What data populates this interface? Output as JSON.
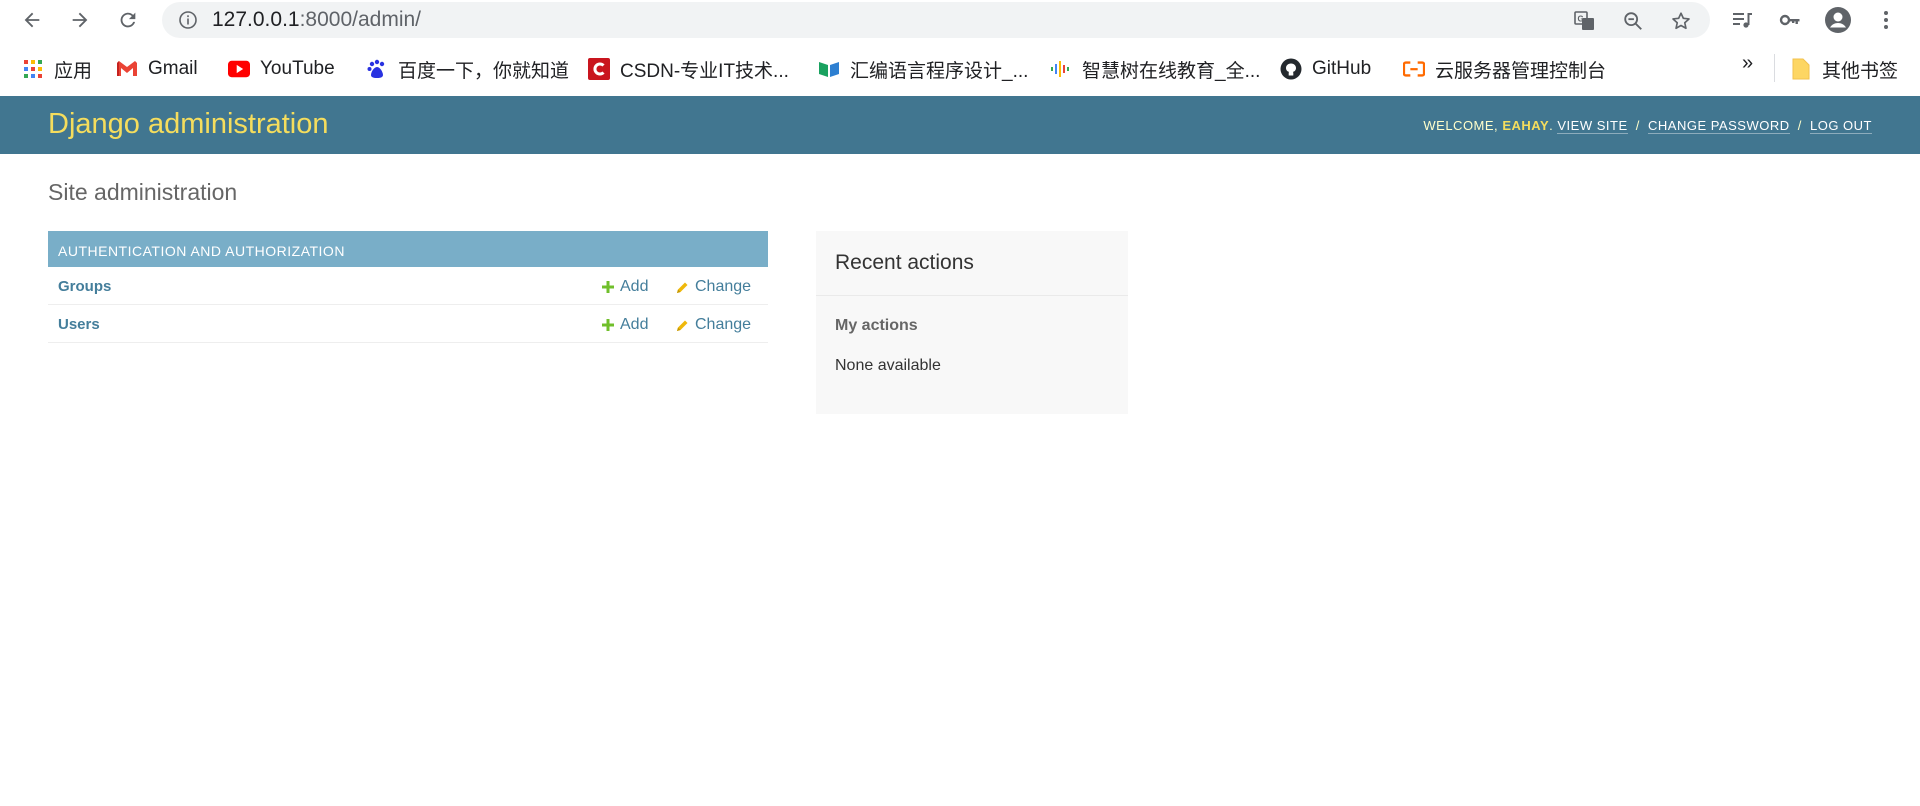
{
  "browser": {
    "url_host": "127.0.0.1",
    "url_rest": ":8000/admin/",
    "bookmarks": [
      {
        "label": "应用",
        "icon": "apps-grid-icon"
      },
      {
        "label": "Gmail",
        "icon": "gmail-icon"
      },
      {
        "label": "YouTube",
        "icon": "youtube-icon"
      },
      {
        "label": "百度一下，你就知道",
        "icon": "baidu-paw-icon"
      },
      {
        "label": "CSDN-专业IT技术...",
        "icon": "csdn-icon"
      },
      {
        "label": "汇编语言程序设计_...",
        "icon": "book-icon"
      },
      {
        "label": "智慧树在线教育_全...",
        "icon": "audio-wave-icon"
      },
      {
        "label": "GitHub",
        "icon": "github-icon"
      },
      {
        "label": "云服务器管理控制台",
        "icon": "aliyun-icon"
      }
    ],
    "overflow_label": "»",
    "other_bookmarks": "其他书签"
  },
  "header": {
    "branding": "Django administration",
    "welcome": "WELCOME,",
    "username": "EAHAY",
    "view_site": "VIEW SITE",
    "change_password": "CHANGE PASSWORD",
    "log_out": "LOG OUT",
    "sep": "/"
  },
  "content": {
    "title": "Site administration",
    "app_caption": "Authentication and Authorization",
    "models": [
      {
        "name": "Groups",
        "add": "Add",
        "change": "Change"
      },
      {
        "name": "Users",
        "add": "Add",
        "change": "Change"
      }
    ]
  },
  "recent": {
    "title": "Recent actions",
    "subtitle": "My actions",
    "empty": "None available"
  },
  "colors": {
    "header_bg": "#417690",
    "branding": "#f5dd5d",
    "caption_bg": "#79aec8",
    "link": "#447e9b",
    "add_icon": "#70bf2b",
    "change_icon": "#efb80b"
  }
}
